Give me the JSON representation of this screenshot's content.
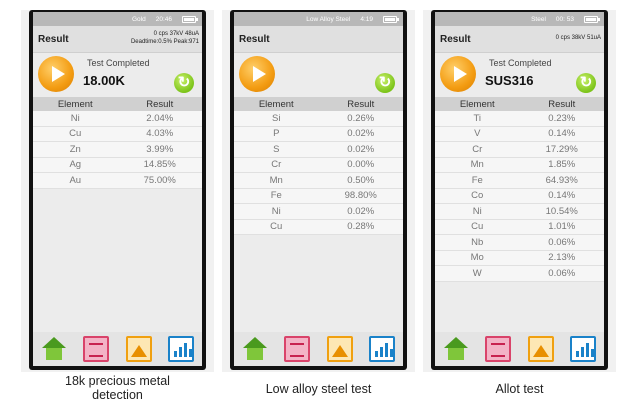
{
  "panels": [
    {
      "status": {
        "title": "Gold",
        "time": "20:46"
      },
      "result_label": "Result",
      "info_line1": "0 cps 37kV 48uA",
      "info_line2": "Deadtime:0.5% Peak:971",
      "test_completed": "Test Completed",
      "test_value": "18.00K",
      "header": {
        "element": "Element",
        "result": "Result"
      },
      "rows": [
        {
          "element": "Ni",
          "result": "2.04%"
        },
        {
          "element": "Cu",
          "result": "4.03%"
        },
        {
          "element": "Zn",
          "result": "3.99%"
        },
        {
          "element": "Ag",
          "result": "14.85%"
        },
        {
          "element": "Au",
          "result": "75.00%"
        }
      ],
      "caption_line1": "18k precious metal",
      "caption_line2": "detection"
    },
    {
      "status": {
        "title": "Low Alloy Steel",
        "time": "4:19"
      },
      "result_label": "Result",
      "header": {
        "element": "Element",
        "result": "Result"
      },
      "rows": [
        {
          "element": "Si",
          "result": "0.26%"
        },
        {
          "element": "P",
          "result": "0.02%"
        },
        {
          "element": "S",
          "result": "0.02%"
        },
        {
          "element": "Cr",
          "result": "0.00%"
        },
        {
          "element": "Mn",
          "result": "0.50%"
        },
        {
          "element": "Fe",
          "result": "98.80%"
        },
        {
          "element": "Ni",
          "result": "0.02%"
        },
        {
          "element": "Cu",
          "result": "0.28%"
        }
      ],
      "caption_line1": "Low alloy steel test"
    },
    {
      "status": {
        "title": "Steel",
        "time": "00: 53"
      },
      "result_label": "Result",
      "info_line1": "0 cps 38kV 51uA",
      "test_completed": "Test Completed",
      "test_value": "SUS316",
      "header": {
        "element": "Element",
        "result": "Result"
      },
      "rows": [
        {
          "element": "Ti",
          "result": "0.23%"
        },
        {
          "element": "V",
          "result": "0.14%"
        },
        {
          "element": "Cr",
          "result": "17.29%"
        },
        {
          "element": "Mn",
          "result": "1.85%"
        },
        {
          "element": "Fe",
          "result": "64.93%"
        },
        {
          "element": "Co",
          "result": "0.14%"
        },
        {
          "element": "Ni",
          "result": "10.54%"
        },
        {
          "element": "Cu",
          "result": "1.01%"
        },
        {
          "element": "Nb",
          "result": "0.06%"
        },
        {
          "element": "Mo",
          "result": "2.13%"
        },
        {
          "element": "W",
          "result": "0.06%"
        }
      ],
      "caption_line1": "Allot test"
    }
  ],
  "icons": [
    "home-icon",
    "report-icon",
    "spectrum-icon",
    "chart-icon"
  ],
  "colors": {
    "play": "#f39c12",
    "refresh": "#7cc41a",
    "home": "#4a9a1e",
    "report": "#d9436a",
    "spectrum": "#f0a010",
    "chart": "#1a82c9"
  }
}
